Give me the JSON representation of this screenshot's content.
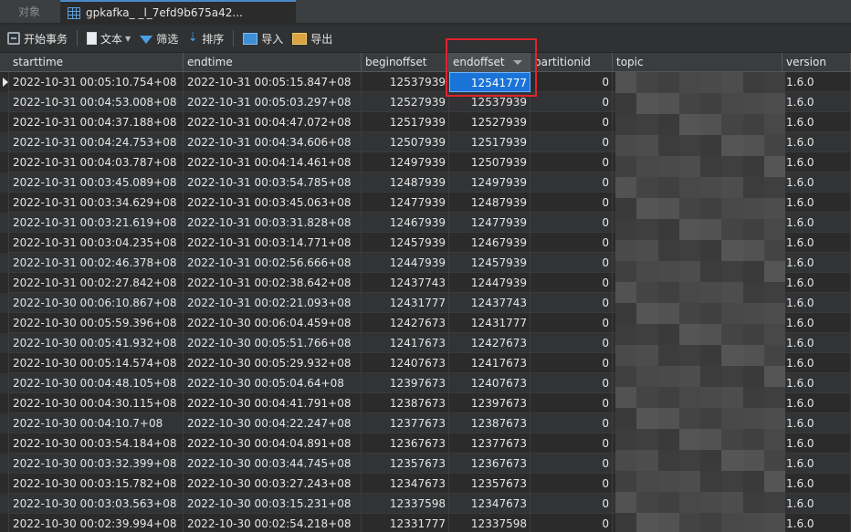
{
  "tabs": {
    "objects_label": "对象",
    "active_title": "gpkafka_           _l_7efd9b675a42..."
  },
  "toolbar": {
    "begin_tx": "开始事务",
    "text": "文本",
    "filter": "筛选",
    "sort": "排序",
    "import": "导入",
    "export": "导出",
    "icons": [
      "transaction-icon",
      "text-icon",
      "filter-icon",
      "sort-icon",
      "import-icon",
      "export-icon"
    ]
  },
  "grid": {
    "columns": [
      "starttime",
      "endtime",
      "beginoffset",
      "endoffset",
      "partitionid",
      "topic",
      "version"
    ],
    "sorted_column": "endoffset",
    "selected_cell": {
      "row": 0,
      "column": "endoffset",
      "value": "12541777"
    },
    "rows": [
      [
        "2022-10-31 00:05:10.754+08",
        "2022-10-31 00:05:15.847+08",
        "12537939",
        "12541777",
        "0",
        "",
        "1.6.0"
      ],
      [
        "2022-10-31 00:04:53.008+08",
        "2022-10-31 00:05:03.297+08",
        "12527939",
        "12537939",
        "0",
        "",
        "1.6.0"
      ],
      [
        "2022-10-31 00:04:37.188+08",
        "2022-10-31 00:04:47.072+08",
        "12517939",
        "12527939",
        "0",
        "",
        "1.6.0"
      ],
      [
        "2022-10-31 00:04:24.753+08",
        "2022-10-31 00:04:34.606+08",
        "12507939",
        "12517939",
        "0",
        "",
        "1.6.0"
      ],
      [
        "2022-10-31 00:04:03.787+08",
        "2022-10-31 00:04:14.461+08",
        "12497939",
        "12507939",
        "0",
        "",
        "1.6.0"
      ],
      [
        "2022-10-31 00:03:45.089+08",
        "2022-10-31 00:03:54.785+08",
        "12487939",
        "12497939",
        "0",
        "",
        "1.6.0"
      ],
      [
        "2022-10-31 00:03:34.629+08",
        "2022-10-31 00:03:45.063+08",
        "12477939",
        "12487939",
        "0",
        "",
        "1.6.0"
      ],
      [
        "2022-10-31 00:03:21.619+08",
        "2022-10-31 00:03:31.828+08",
        "12467939",
        "12477939",
        "0",
        "",
        "1.6.0"
      ],
      [
        "2022-10-31 00:03:04.235+08",
        "2022-10-31 00:03:14.771+08",
        "12457939",
        "12467939",
        "0",
        "",
        "1.6.0"
      ],
      [
        "2022-10-31 00:02:46.378+08",
        "2022-10-31 00:02:56.666+08",
        "12447939",
        "12457939",
        "0",
        "",
        "1.6.0"
      ],
      [
        "2022-10-31 00:02:27.842+08",
        "2022-10-31 00:02:38.642+08",
        "12437743",
        "12447939",
        "0",
        "",
        "1.6.0"
      ],
      [
        "2022-10-30 00:06:10.867+08",
        "2022-10-31 00:02:21.093+08",
        "12431777",
        "12437743",
        "0",
        "",
        "1.6.0"
      ],
      [
        "2022-10-30 00:05:59.396+08",
        "2022-10-30 00:06:04.459+08",
        "12427673",
        "12431777",
        "0",
        "",
        "1.6.0"
      ],
      [
        "2022-10-30 00:05:41.932+08",
        "2022-10-30 00:05:51.766+08",
        "12417673",
        "12427673",
        "0",
        "",
        "1.6.0"
      ],
      [
        "2022-10-30 00:05:14.574+08",
        "2022-10-30 00:05:29.932+08",
        "12407673",
        "12417673",
        "0",
        "",
        "1.6.0"
      ],
      [
        "2022-10-30 00:04:48.105+08",
        "2022-10-30 00:05:04.64+08",
        "12397673",
        "12407673",
        "0",
        "",
        "1.6.0"
      ],
      [
        "2022-10-30 00:04:30.115+08",
        "2022-10-30 00:04:41.791+08",
        "12387673",
        "12397673",
        "0",
        "",
        "1.6.0"
      ],
      [
        "2022-10-30 00:04:10.7+08",
        "2022-10-30 00:04:22.247+08",
        "12377673",
        "12387673",
        "0",
        "",
        "1.6.0"
      ],
      [
        "2022-10-30 00:03:54.184+08",
        "2022-10-30 00:04:04.891+08",
        "12367673",
        "12377673",
        "0",
        "",
        "1.6.0"
      ],
      [
        "2022-10-30 00:03:32.399+08",
        "2022-10-30 00:03:44.745+08",
        "12357673",
        "12367673",
        "0",
        "",
        "1.6.0"
      ],
      [
        "2022-10-30 00:03:15.782+08",
        "2022-10-30 00:03:27.243+08",
        "12347673",
        "12357673",
        "0",
        "",
        "1.6.0"
      ],
      [
        "2022-10-30 00:03:03.563+08",
        "2022-10-30 00:03:15.231+08",
        "12337598",
        "12347673",
        "0",
        "",
        "1.6.0"
      ],
      [
        "2022-10-30 00:02:39.994+08",
        "2022-10-30 00:02:54.218+08",
        "12331777",
        "12337598",
        "0",
        "",
        "1.6.0"
      ]
    ]
  },
  "colors": {
    "selection": "#1a73d9",
    "highlight_box": "#e0242d"
  }
}
